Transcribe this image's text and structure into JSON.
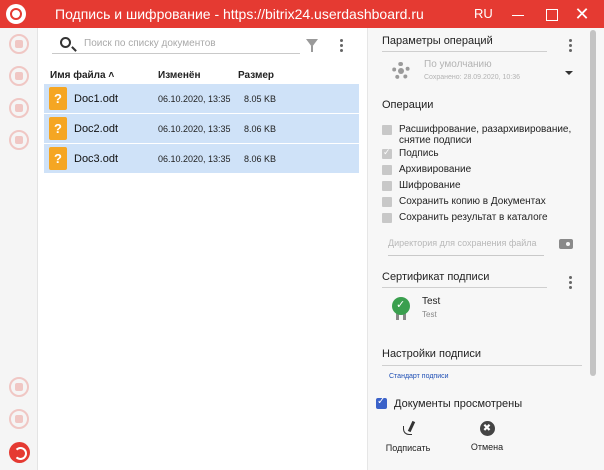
{
  "window": {
    "title": "Подпись и шифрование - https://bitrix24.userdashboard.ru",
    "language": "RU",
    "close_glyph": "✕"
  },
  "leftbar": {
    "icons": [
      "sign-icon",
      "document-icon",
      "document-lock-icon",
      "users-icon",
      "cloud-icon",
      "notes-icon",
      "exit-icon"
    ]
  },
  "search": {
    "placeholder": "Поиск по списку документов",
    "value": ""
  },
  "table": {
    "columns": {
      "name": "Имя файла ˄",
      "modified": "Изменён",
      "size": "Размер"
    },
    "rows": [
      {
        "icon_glyph": "?",
        "name": "Doc1.odt",
        "modified": "06.10.2020, 13:35",
        "size": "8.05 KB"
      },
      {
        "icon_glyph": "?",
        "name": "Doc2.odt",
        "modified": "06.10.2020, 13:35",
        "size": "8.06 KB"
      },
      {
        "icon_glyph": "?",
        "name": "Doc3.odt",
        "modified": "06.10.2020, 13:35",
        "size": "8.06 KB"
      }
    ]
  },
  "panel": {
    "params_title": "Параметры операций",
    "preset": {
      "name": "По умолчанию",
      "saved": "Сохранено: 28.09.2020, 10:36"
    },
    "operations_title": "Операции",
    "operations": [
      {
        "label": "Расшифрование, разархивирование,",
        "label2": "снятие подписи",
        "checked": false
      },
      {
        "label": "Подпись",
        "checked": true
      },
      {
        "label": "Архивирование",
        "checked": false
      },
      {
        "label": "Шифрование",
        "checked": false
      },
      {
        "label": "Сохранить копию в Документах",
        "checked": false
      },
      {
        "label": "Сохранить результат в каталоге",
        "checked": false
      }
    ],
    "directory_placeholder": "Директория для сохранения файла",
    "certificate_title": "Сертификат подписи",
    "certificate": {
      "name": "Test",
      "issuer": "Test"
    },
    "signature_settings_title": "Настройки подписи",
    "signature_standard_link": "Стандарт подписи",
    "documents_viewed_label": "Документы просмотрены",
    "documents_viewed_checked": true,
    "sign_label": "Подписать",
    "cancel_label": "Отмена",
    "cancel_glyph": "✖"
  },
  "colors": {
    "titlebar": "#e53a32",
    "selected_row": "#cfe2f8",
    "file_icon": "#f5a623",
    "checkbox_checked": "#3b62c9",
    "link": "#1f4fb5",
    "cert_ok": "#3a9f4e"
  }
}
